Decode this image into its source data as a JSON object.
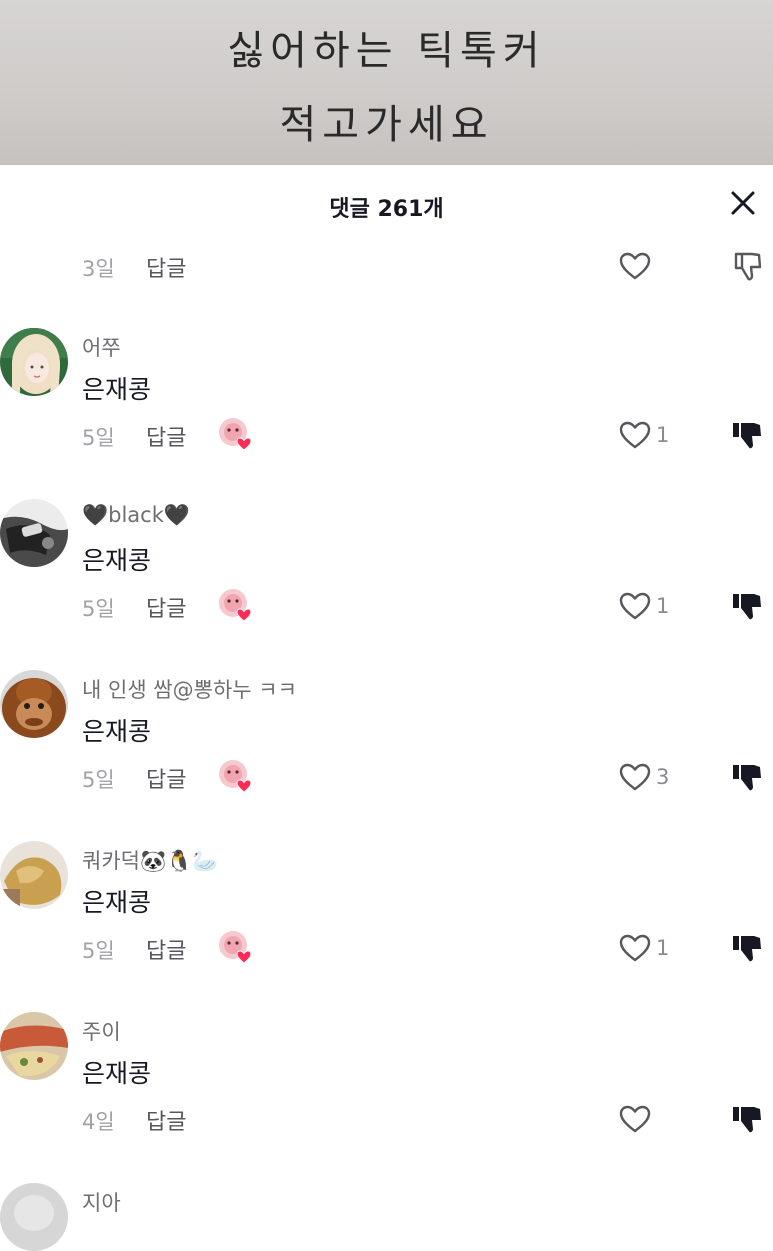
{
  "video_overlay": {
    "line1": "싫어하는 틱톡커",
    "line2": "적고가세요"
  },
  "header": {
    "title": "댓글 261개"
  },
  "partial_top": {
    "time": "3일",
    "reply": "답글"
  },
  "comments": [
    {
      "username": "어쭈",
      "text": "은재콩",
      "time": "5일",
      "reply": "답글",
      "likes": "1"
    },
    {
      "username": "🖤black🖤",
      "text": "은재콩",
      "time": "5일",
      "reply": "답글",
      "likes": "1"
    },
    {
      "username": "내 인생 쌈@뽕하누 ㅋㅋ",
      "text": "은재콩",
      "time": "5일",
      "reply": "답글",
      "likes": "3"
    },
    {
      "username": "쿼카덕🐼🐧🦢",
      "text": "은재콩",
      "time": "5일",
      "reply": "답글",
      "likes": "1"
    },
    {
      "username": "주이",
      "text": "은재콩",
      "time": "4일",
      "reply": "답글",
      "likes": ""
    },
    {
      "username": "지아",
      "text": "",
      "time": "",
      "reply": "",
      "likes": ""
    }
  ],
  "colors": {
    "primary_text": "#161823",
    "secondary_text": "#6e6e73",
    "time_text": "#a1a1a6",
    "creator_heart": "#fe2c55"
  }
}
